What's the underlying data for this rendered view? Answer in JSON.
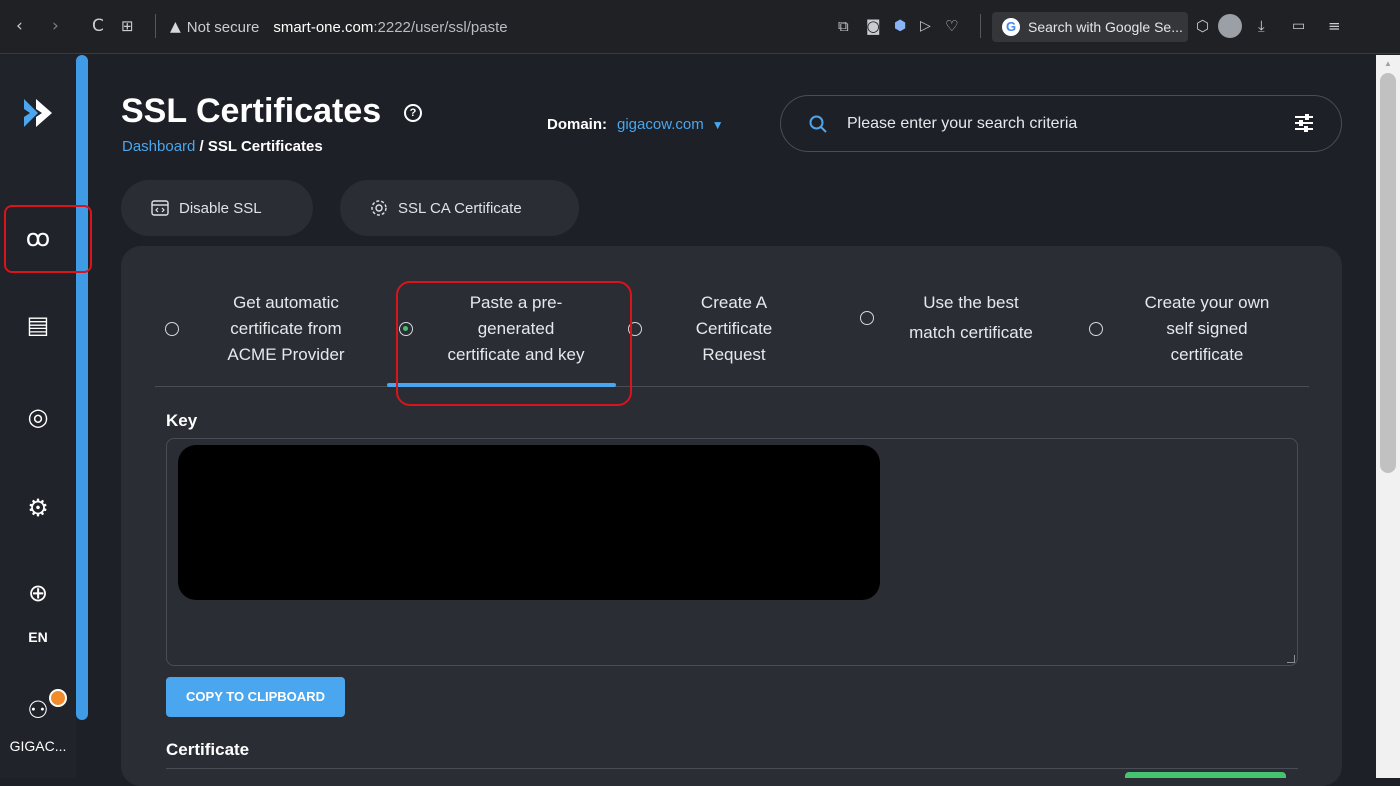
{
  "browser": {
    "back_glyph": "‹",
    "forward_glyph": "›",
    "reload_glyph": "C",
    "security_label": "Not secure",
    "url_host": "smart-one.com",
    "url_path": ":2222/user/ssl/paste",
    "search_engine_label": "Search with Google Se..."
  },
  "sidebar": {
    "language": "EN",
    "user": "GIGAC..."
  },
  "header": {
    "title": "SSL Certificates",
    "breadcrumb_home": "Dashboard",
    "breadcrumb_sep": " / ",
    "breadcrumb_current": "SSL Certificates",
    "domain_label": "Domain:",
    "domain_value": "gigacow.com",
    "search_placeholder": "Please enter your search criteria"
  },
  "actions": {
    "disable_ssl": "Disable SSL",
    "ssl_ca": "SSL CA Certificate"
  },
  "options": [
    {
      "line1": "Get automatic",
      "line2": "certificate from",
      "line3": "ACME Provider",
      "selected": false
    },
    {
      "line1": "Paste a pre-",
      "line2": "generated",
      "line3": "certificate and key",
      "selected": true
    },
    {
      "line1": "Create A",
      "line2": "Certificate",
      "line3": "Request",
      "selected": false
    },
    {
      "line1": "Use the best",
      "line2": "match certificate",
      "line3": "",
      "selected": false
    },
    {
      "line1": "Create your own",
      "line2": "self signed",
      "line3": "certificate",
      "selected": false
    }
  ],
  "form": {
    "key_label": "Key",
    "copy_button": "COPY TO CLIPBOARD",
    "certificate_label": "Certificate"
  },
  "colors": {
    "accent": "#4aa6ee",
    "highlight": "#d9141a",
    "success": "#46c36f",
    "notification": "#f08c2c"
  }
}
